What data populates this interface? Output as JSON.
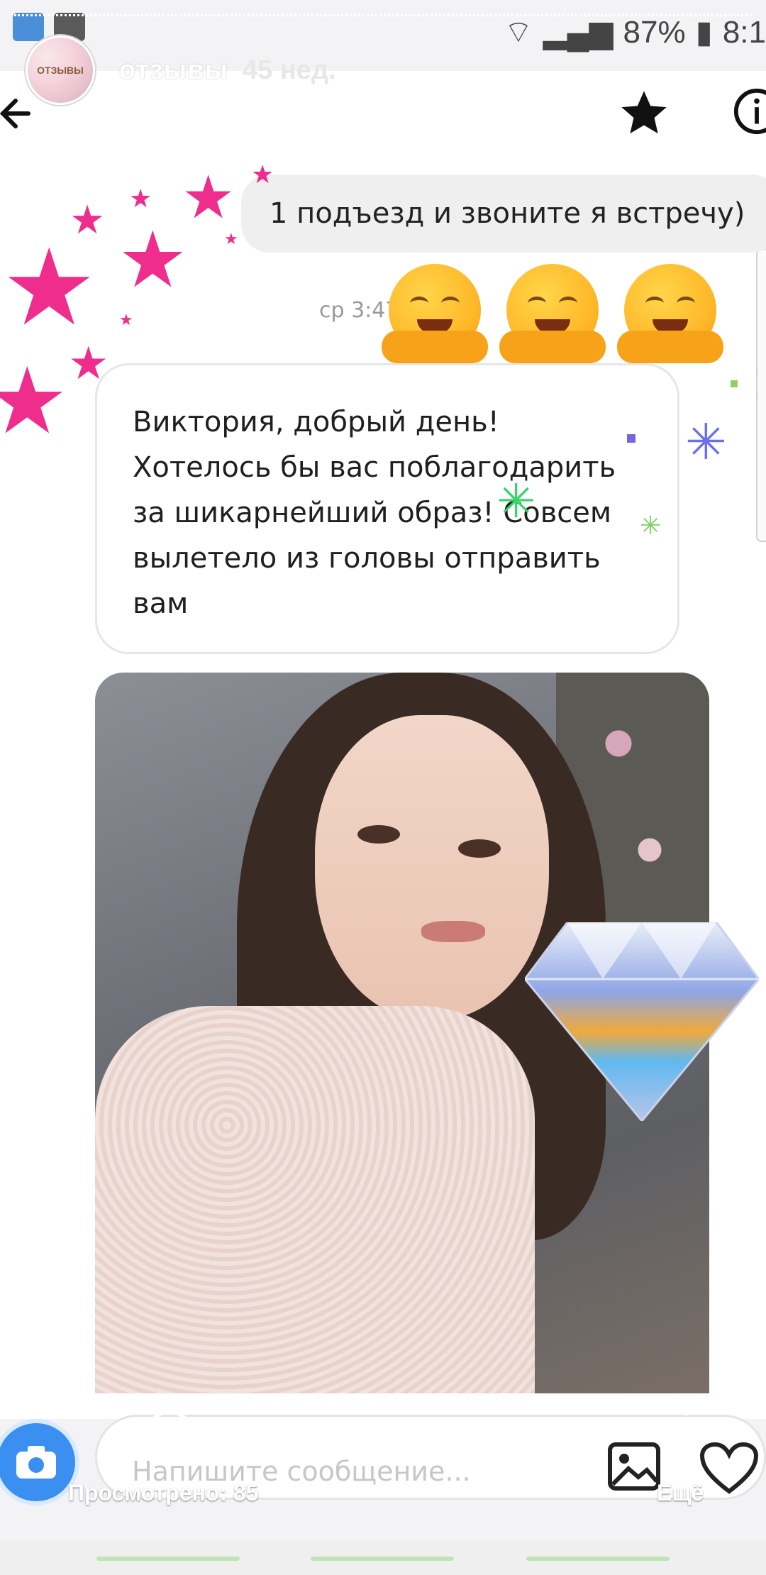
{
  "status_bar": {
    "battery": "87%",
    "time": "8:1",
    "icons": [
      "wifi-icon",
      "signal-icon",
      "battery-icon"
    ]
  },
  "story": {
    "account_name": "отзывы",
    "posted_ago": "45 нед.",
    "avatar_text": "ОТЗЫВЫ"
  },
  "dm_header": {
    "icons": [
      "back-arrow-icon",
      "star-icon",
      "info-icon"
    ]
  },
  "chat": {
    "received_top": "1 подъезд и звоните я встречу)",
    "timestamp": "ср 3:47",
    "emoji_count": 3,
    "message_lines": [
      "Виктория, добрый день!",
      "Хотелось бы вас поблагодарить",
      "за шикарнейший образ! Совсем",
      "вылетело из головы отправить",
      "вам"
    ]
  },
  "composer": {
    "placeholder": "Напишите сообщение..."
  },
  "story_footer": {
    "viewed": "Просмотрено: 85",
    "more": "Ещё"
  },
  "colors": {
    "star_pink": "#ee2d8c",
    "camera_blue": "#3a8ff0"
  }
}
